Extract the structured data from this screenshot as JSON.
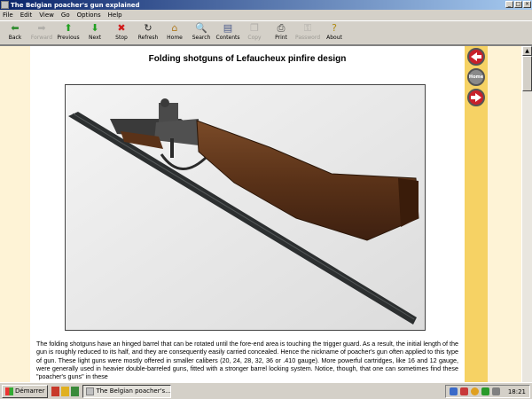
{
  "window": {
    "title": "The Belgian poacher's gun explained",
    "controls": [
      "_",
      "□",
      "×"
    ]
  },
  "menu": [
    "File",
    "Edit",
    "View",
    "Go",
    "Options",
    "Help"
  ],
  "toolbar": [
    {
      "label": "Back",
      "icon": "back-arrow-icon",
      "glyph": "⬅",
      "color": "#2a8a2a",
      "enabled": true
    },
    {
      "label": "Forward",
      "icon": "forward-arrow-icon",
      "glyph": "➡",
      "color": "#7a7a7a",
      "enabled": false
    },
    {
      "label": "Previous",
      "icon": "up-arrow-icon",
      "glyph": "⬆",
      "color": "#22a022",
      "enabled": true
    },
    {
      "label": "Next",
      "icon": "down-arrow-icon",
      "glyph": "⬇",
      "color": "#22a022",
      "enabled": true
    },
    {
      "label": "Stop",
      "icon": "stop-icon",
      "glyph": "✖",
      "color": "#d01a1a",
      "enabled": true
    },
    {
      "label": "Refresh",
      "icon": "refresh-icon",
      "glyph": "↻",
      "color": "#2a2a2a",
      "enabled": true
    },
    {
      "label": "Home",
      "icon": "home-icon",
      "glyph": "⌂",
      "color": "#b07a20",
      "enabled": true
    },
    {
      "label": "Search",
      "icon": "search-icon",
      "glyph": "🔍",
      "color": "#2a2a2a",
      "enabled": true
    },
    {
      "label": "Contents",
      "icon": "contents-icon",
      "glyph": "▤",
      "color": "#4a5a8a",
      "enabled": true
    },
    {
      "label": "Copy",
      "icon": "copy-icon",
      "glyph": "❐",
      "color": "#7a7a7a",
      "enabled": false
    },
    {
      "label": "Print",
      "icon": "print-icon",
      "glyph": "⎙",
      "color": "#3a3a3a",
      "enabled": true
    },
    {
      "label": "Password",
      "icon": "key-icon",
      "glyph": "⚿",
      "color": "#7a7a7a",
      "enabled": false
    },
    {
      "label": "About",
      "icon": "question-icon",
      "glyph": "?",
      "color": "#b08a10",
      "enabled": true
    }
  ],
  "page": {
    "title": "Folding shotguns of Lefaucheux pinfire design",
    "body": "The folding shotguns have an hinged barrel that can be rotated until the fore-end area is touching the trigger guard. As a result, the initial length of the gun is roughly reduced to its half, and they are consequently easily carried concealed. Hence the nickname of poacher's gun often applied to this type of gun. These light guns were mostly offered in smaller calibers (20, 24, 28, 32, 36 or .410 gauge). More powerful cartridges, like 16 and 12 gauge, were generally used in heavier double-barreled guns, fitted with a stronger barrel locking system. Notice, though, that one can sometimes find these \"poacher's guns\" in these"
  },
  "nav_buttons": [
    {
      "name": "prev-page-button",
      "label": "",
      "color": "#c8202a"
    },
    {
      "name": "home-page-button",
      "label": "Home",
      "color": "#8a8a8a"
    },
    {
      "name": "next-page-button",
      "label": "",
      "color": "#c8202a"
    }
  ],
  "taskbar": {
    "start_label": "Démarrer",
    "task_label": "The Belgian poacher's...",
    "clock": "18:21"
  },
  "colors": {
    "margin": "#fef3d6",
    "accent_strip": "#f6d264",
    "title_gradient_start": "#0a246a"
  }
}
